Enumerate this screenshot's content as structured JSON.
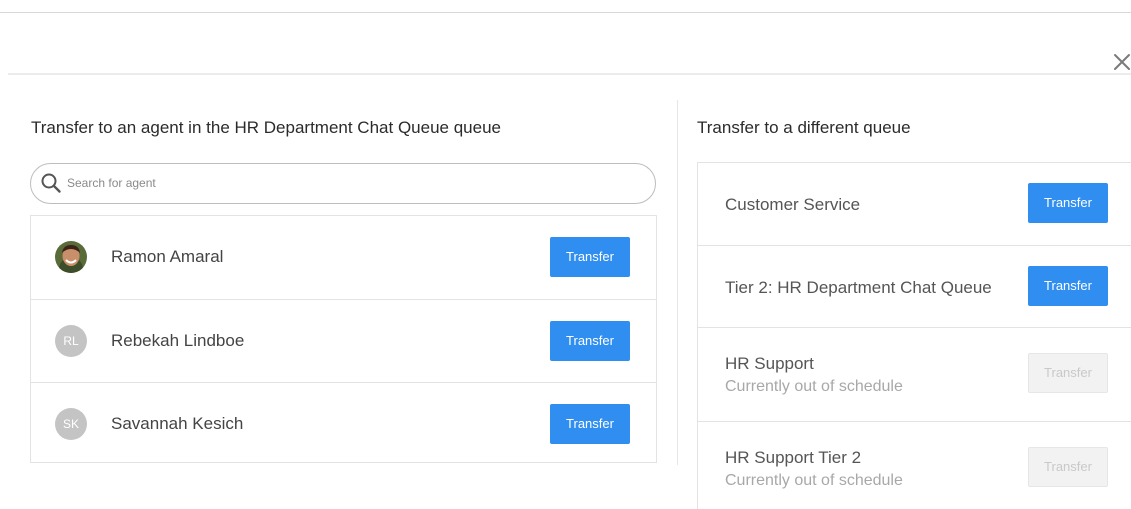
{
  "dialog": {
    "close_icon": "close-icon"
  },
  "agents_section": {
    "title": "Transfer to an agent in the HR Department Chat Queue queue",
    "search": {
      "placeholder": "Search for agent",
      "value": "",
      "icon": "search-icon"
    },
    "agents": [
      {
        "name": "Ramon Amaral",
        "avatar": "photo",
        "initials": "",
        "button_label": "Transfer"
      },
      {
        "name": "Rebekah Lindboe",
        "avatar": "initials",
        "initials": "RL",
        "button_label": "Transfer"
      },
      {
        "name": "Savannah Kesich",
        "avatar": "initials",
        "initials": "SK",
        "button_label": "Transfer"
      }
    ]
  },
  "queues_section": {
    "title": "Transfer to a different queue",
    "queues": [
      {
        "name": "Customer Service",
        "status": "",
        "button_label": "Transfer",
        "enabled": true
      },
      {
        "name": "Tier 2: HR Department Chat Queue",
        "status": "",
        "button_label": "Transfer",
        "enabled": true
      },
      {
        "name": "HR Support",
        "status": "Currently out of schedule",
        "button_label": "Transfer",
        "enabled": false
      },
      {
        "name": "HR Support Tier 2",
        "status": "Currently out of schedule",
        "button_label": "Transfer",
        "enabled": false
      }
    ]
  },
  "colors": {
    "accent": "#2f8ef0",
    "disabled_button": "#f2f2f2",
    "avatar_initials_bg": "#c4c4c4"
  }
}
